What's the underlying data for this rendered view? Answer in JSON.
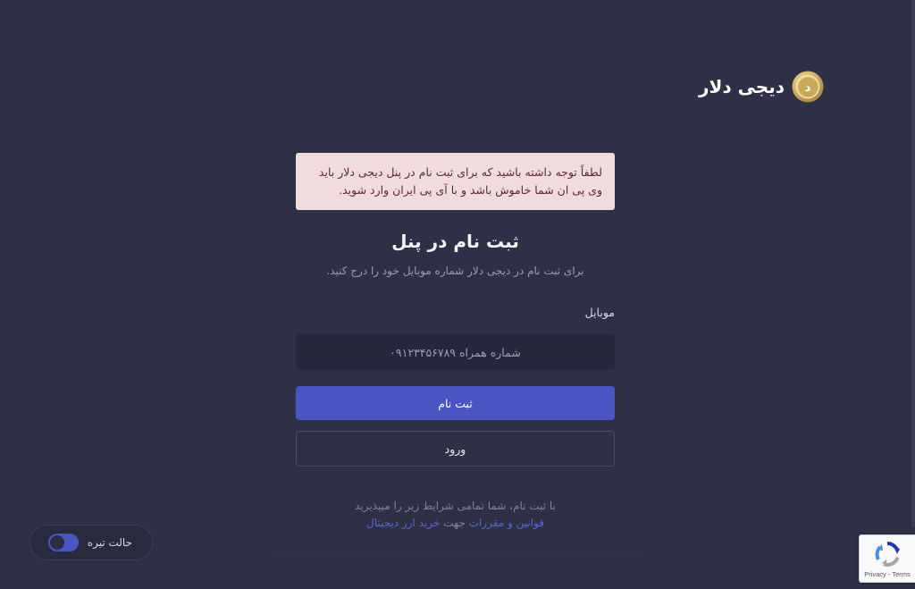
{
  "logo": {
    "text": "دیجی دلار",
    "coin_glyph": "د"
  },
  "alert": {
    "line1": "لطفاً توجه داشته باشید که برای ثبت نام در پنل دیجی دلار باید",
    "line2": "وی پی ان شما خاموش باشد و با آی پی ایران وارد شوید."
  },
  "page": {
    "title": "ثبت نام در پنل",
    "subtitle": "برای ثبت نام در دیجی دلار شماره موبایل خود را درج کنید."
  },
  "form": {
    "mobile_label": "موبایل",
    "mobile_value": "",
    "mobile_placeholder": "شماره همراه ۰۹۱۲۳۴۵۶۷۸۹",
    "register_label": "ثبت نام",
    "login_label": "ورود"
  },
  "terms": {
    "line1": "با ثبت نام، شما تمامی شرایط زیر را میپذیرید",
    "link_text": "قوانین و مقررات",
    "middle_text": " جهت ",
    "link2_text": "خرید ارز دیجیتال"
  },
  "dark_mode": {
    "label": "حالت تیره",
    "enabled": true
  },
  "recaptcha": {
    "links": "Privacy - Terms"
  },
  "colors": {
    "background": "#2e3045",
    "primary": "#4a55c1",
    "alert_bg": "#f1dcdd",
    "alert_text": "#5c2b30",
    "input_bg": "#26273a",
    "link": "#5c66cf"
  },
  "icons": {
    "logo": "coin-icon",
    "recaptcha": "recaptcha-icon"
  }
}
